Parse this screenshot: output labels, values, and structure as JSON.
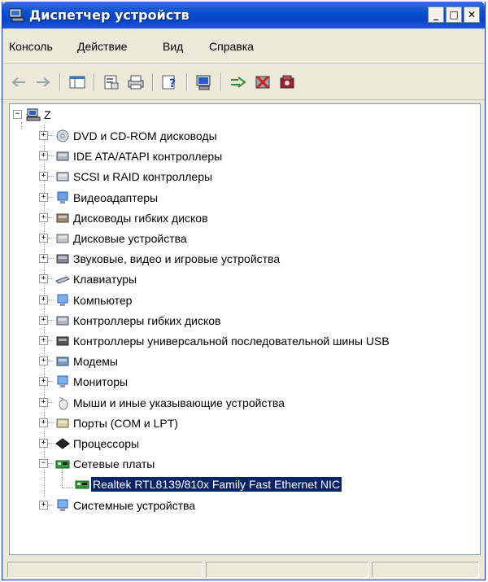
{
  "window": {
    "title": "Диспетчер устройств",
    "buttons": {
      "minimize": "_",
      "maximize": "□",
      "close": "✕"
    }
  },
  "menu": [
    "Консоль",
    "Действие",
    "Вид",
    "Справка"
  ],
  "toolbar": [
    {
      "icon": "back-arrow-icon"
    },
    {
      "icon": "forward-arrow-icon"
    },
    {
      "icon": "show-hide-tree-icon"
    },
    {
      "icon": "properties-icon"
    },
    {
      "icon": "print-icon"
    },
    {
      "icon": "help-icon"
    },
    {
      "icon": "scan-hardware-icon"
    },
    {
      "icon": "update-driver-icon"
    },
    {
      "icon": "uninstall-icon"
    },
    {
      "icon": "disable-device-icon"
    }
  ],
  "tree": {
    "root": "Z",
    "categories": [
      {
        "label": "DVD и CD-ROM дисководы",
        "icon": "cdrom-icon",
        "expander": "+"
      },
      {
        "label": "IDE ATA/ATAPI контроллеры",
        "icon": "ide-controller-icon",
        "expander": "+"
      },
      {
        "label": "SCSI и RAID контроллеры",
        "icon": "scsi-controller-icon",
        "expander": "+"
      },
      {
        "label": "Видеоадаптеры",
        "icon": "display-adapter-icon",
        "expander": "+"
      },
      {
        "label": "Дисководы гибких дисков",
        "icon": "floppy-drive-icon",
        "expander": "+"
      },
      {
        "label": "Дисковые устройства",
        "icon": "disk-drive-icon",
        "expander": "+"
      },
      {
        "label": "Звуковые, видео и игровые устройства",
        "icon": "sound-icon",
        "expander": "+"
      },
      {
        "label": "Клавиатуры",
        "icon": "keyboard-icon",
        "expander": "+"
      },
      {
        "label": "Компьютер",
        "icon": "computer-icon",
        "expander": "+"
      },
      {
        "label": "Контроллеры гибких дисков",
        "icon": "floppy-controller-icon",
        "expander": "+"
      },
      {
        "label": "Контроллеры универсальной последовательной шины USB",
        "icon": "usb-icon",
        "expander": "+"
      },
      {
        "label": "Модемы",
        "icon": "modem-icon",
        "expander": "+"
      },
      {
        "label": "Мониторы",
        "icon": "monitor-icon",
        "expander": "+"
      },
      {
        "label": "Мыши и иные указывающие устройства",
        "icon": "mouse-icon",
        "expander": "+"
      },
      {
        "label": "Порты (COM и LPT)",
        "icon": "port-icon",
        "expander": "+"
      },
      {
        "label": "Процессоры",
        "icon": "processor-icon",
        "expander": "+"
      },
      {
        "label": "Сетевые платы",
        "icon": "network-card-icon",
        "expander": "−",
        "children": [
          {
            "label": "Realtek RTL8139/810x Family Fast Ethernet NIC",
            "icon": "network-card-icon",
            "selected": true
          }
        ]
      },
      {
        "label": "Системные устройства",
        "icon": "system-devices-icon",
        "expander": "+"
      }
    ]
  },
  "status": [
    "",
    "",
    ""
  ],
  "colors": {
    "titlebar": "#0a46c4",
    "selection": "#0a246a",
    "chrome": "#ece9d8"
  }
}
